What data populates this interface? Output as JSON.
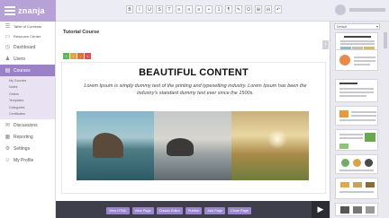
{
  "app": {
    "name": "znanja"
  },
  "toolbar": {
    "buttons": [
      "B",
      "I",
      "U",
      "S",
      "T",
      "≡",
      "≡",
      "≡",
      "•",
      "1",
      "¶",
      "✎",
      "Ω",
      "⊞",
      "⊟",
      "↶"
    ]
  },
  "sidebar": {
    "items": [
      {
        "label": "Table of Contents",
        "icon": "list-icon"
      },
      {
        "label": "Resource Center",
        "icon": "folder-icon"
      },
      {
        "label": "Dashboard",
        "icon": "dashboard-icon"
      },
      {
        "label": "Users",
        "icon": "users-icon"
      },
      {
        "label": "Courses",
        "icon": "courses-icon"
      }
    ],
    "course_subitems": [
      "My Courses",
      "Notes",
      "Orders",
      "Templates",
      "Categories",
      "Certificates"
    ],
    "lower_items": [
      {
        "label": "Discussions",
        "icon": "chat-icon"
      },
      {
        "label": "Reporting",
        "icon": "chart-icon"
      },
      {
        "label": "Settings",
        "icon": "gear-icon"
      },
      {
        "label": "My Profile",
        "icon": "user-icon"
      }
    ]
  },
  "main": {
    "course_title": "Tutorial Course",
    "color_buttons": [
      "#5cb85c",
      "#e6a23c",
      "#e2703a",
      "#d9534f"
    ],
    "content": {
      "headline": "BEAUTIFUL CONTENT",
      "body": "Lorem Ipsum is simply dummy text of the printing and typesetting industry. Lorem Ipsum has been the industry's standard dummy text ever since the 1500s."
    }
  },
  "actions": [
    "View HTML",
    "View Page",
    "Classic Editor",
    "Publish",
    "Add Page",
    "Clone Page"
  ],
  "panel": {
    "select_value": "Default"
  }
}
